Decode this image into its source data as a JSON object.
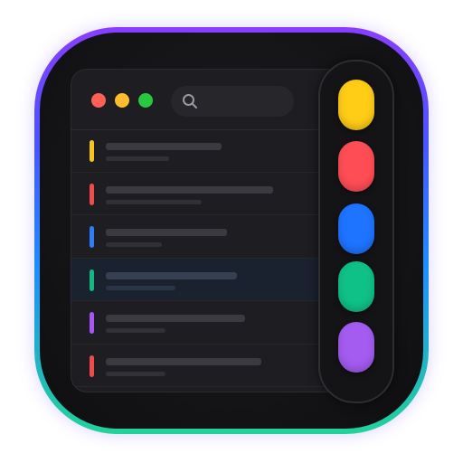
{
  "app": {
    "colors": {
      "frame_gradient": [
        "#8a3dff",
        "#4a54ff",
        "#1f8cff",
        "#21d39a"
      ]
    }
  },
  "window": {
    "traffic_lights": [
      {
        "name": "close",
        "color": "#ff5f57"
      },
      {
        "name": "minimize",
        "color": "#febc2e"
      },
      {
        "name": "zoom",
        "color": "#28c840"
      }
    ],
    "search": {
      "icon": "search-icon",
      "placeholder": ""
    }
  },
  "list": {
    "rows": [
      {
        "tag_color": "#f5c518",
        "selected": false,
        "line1_pct": 0.58,
        "line2_pct": 0.32
      },
      {
        "tag_color": "#ef4b4b",
        "selected": false,
        "line1_pct": 0.84,
        "line2_pct": 0.48
      },
      {
        "tag_color": "#2f7cf6",
        "selected": false,
        "line1_pct": 0.61,
        "line2_pct": 0.28
      },
      {
        "tag_color": "#10b981",
        "selected": true,
        "line1_pct": 0.66,
        "line2_pct": 0.35
      },
      {
        "tag_color": "#a855f7",
        "selected": false,
        "line1_pct": 0.7,
        "line2_pct": 0.3
      },
      {
        "tag_color": "#ef4b4b",
        "selected": false,
        "line1_pct": 0.78,
        "line2_pct": 0.3
      }
    ]
  },
  "side_panel": {
    "buttons": [
      {
        "name": "yellow",
        "color": "#ffcc16"
      },
      {
        "name": "red",
        "color": "#ff4d55"
      },
      {
        "name": "blue",
        "color": "#1e73ff"
      },
      {
        "name": "green",
        "color": "#0fc187"
      },
      {
        "name": "purple",
        "color": "#a45bf0"
      }
    ]
  }
}
